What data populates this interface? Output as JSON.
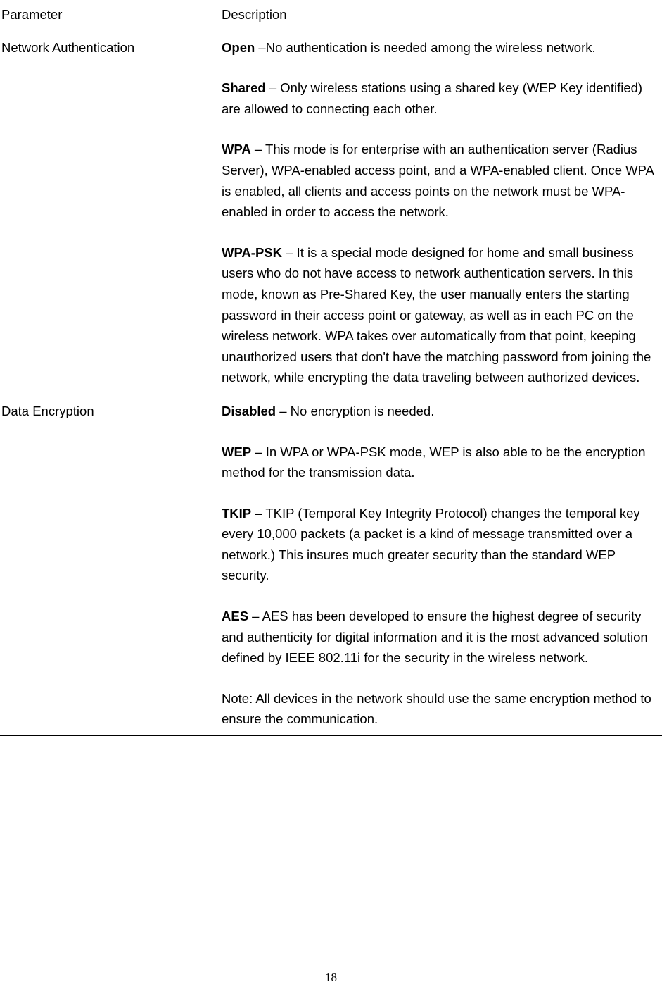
{
  "headers": {
    "param": "Parameter",
    "desc": "Description"
  },
  "rows": [
    {
      "param": "Network Authentication",
      "blocks": [
        {
          "term": "Open ",
          "text": "–No authentication is needed among the wireless network."
        },
        {
          "term": "Shared",
          "text": " – Only wireless stations using a shared key (WEP Key identified) are allowed to connecting each other."
        },
        {
          "term": "WPA",
          "text": " – This mode is for enterprise with an authentication server (Radius Server), WPA-enabled access point, and a WPA-enabled client. Once WPA is enabled, all clients and access points on the network must be WPA-enabled in order to access the network."
        },
        {
          "term": "WPA-PSK",
          "text": " – It is a special mode designed for home and small business users who do not have access to network authentication servers. In this mode, known as Pre-Shared Key, the user manually enters the starting password in their access point or gateway, as well as in each PC on the wireless network. WPA takes over automatically from that point, keeping unauthorized users that don't have the matching password from joining the network, while encrypting the data traveling between authorized devices."
        }
      ]
    },
    {
      "param": "Data Encryption",
      "blocks": [
        {
          "term": "Disabled",
          "text": " – No encryption is needed."
        },
        {
          "term": "WEP",
          "text": " – In WPA or WPA-PSK mode, WEP is also able to be the encryption method for the transmission data."
        },
        {
          "term": "TKIP",
          "text": " – TKIP (Temporal Key Integrity Protocol) changes the temporal key every 10,000 packets (a packet is a kind of message transmitted over a network.) This insures much greater security than the standard WEP security."
        },
        {
          "term": "AES",
          "text": " – AES has been developed to ensure the highest degree of security and authenticity for digital information and it is the most advanced solution defined by IEEE 802.11i for the security in the wireless network."
        },
        {
          "term": "",
          "text": "Note: All devices in the network should use the same encryption method to ensure the communication."
        }
      ]
    }
  ],
  "pageNumber": "18"
}
